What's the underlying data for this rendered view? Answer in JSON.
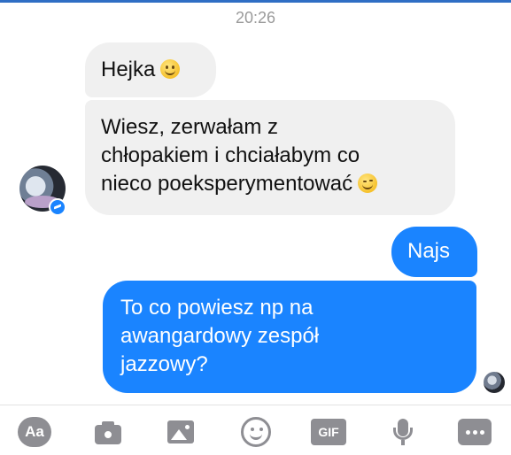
{
  "header": {
    "time": "20:26"
  },
  "messages": [
    {
      "sender": "them",
      "text": "Hejka",
      "emoji": "smile-emoji"
    },
    {
      "sender": "them",
      "lines": [
        "Wiesz, zerwałam z",
        "chłopakiem i chciałabym co",
        "nieco poeksperymentować"
      ],
      "emoji": "wink-emoji"
    },
    {
      "sender": "me",
      "text": "Najs"
    },
    {
      "sender": "me",
      "lines": [
        "To co powiesz np na",
        "awangardowy zespół",
        "jazzowy?"
      ]
    }
  ],
  "toolbar": {
    "aa_label": "Aa",
    "gif_label": "GIF",
    "icons": [
      "aa-icon",
      "camera-icon",
      "image-icon",
      "emoji-icon",
      "gif-icon",
      "microphone-icon",
      "more-icon"
    ]
  },
  "colors": {
    "outgoing_bubble": "#1a84ff",
    "incoming_bubble": "#f0f0f0",
    "icon_gray": "#8e8e93"
  }
}
